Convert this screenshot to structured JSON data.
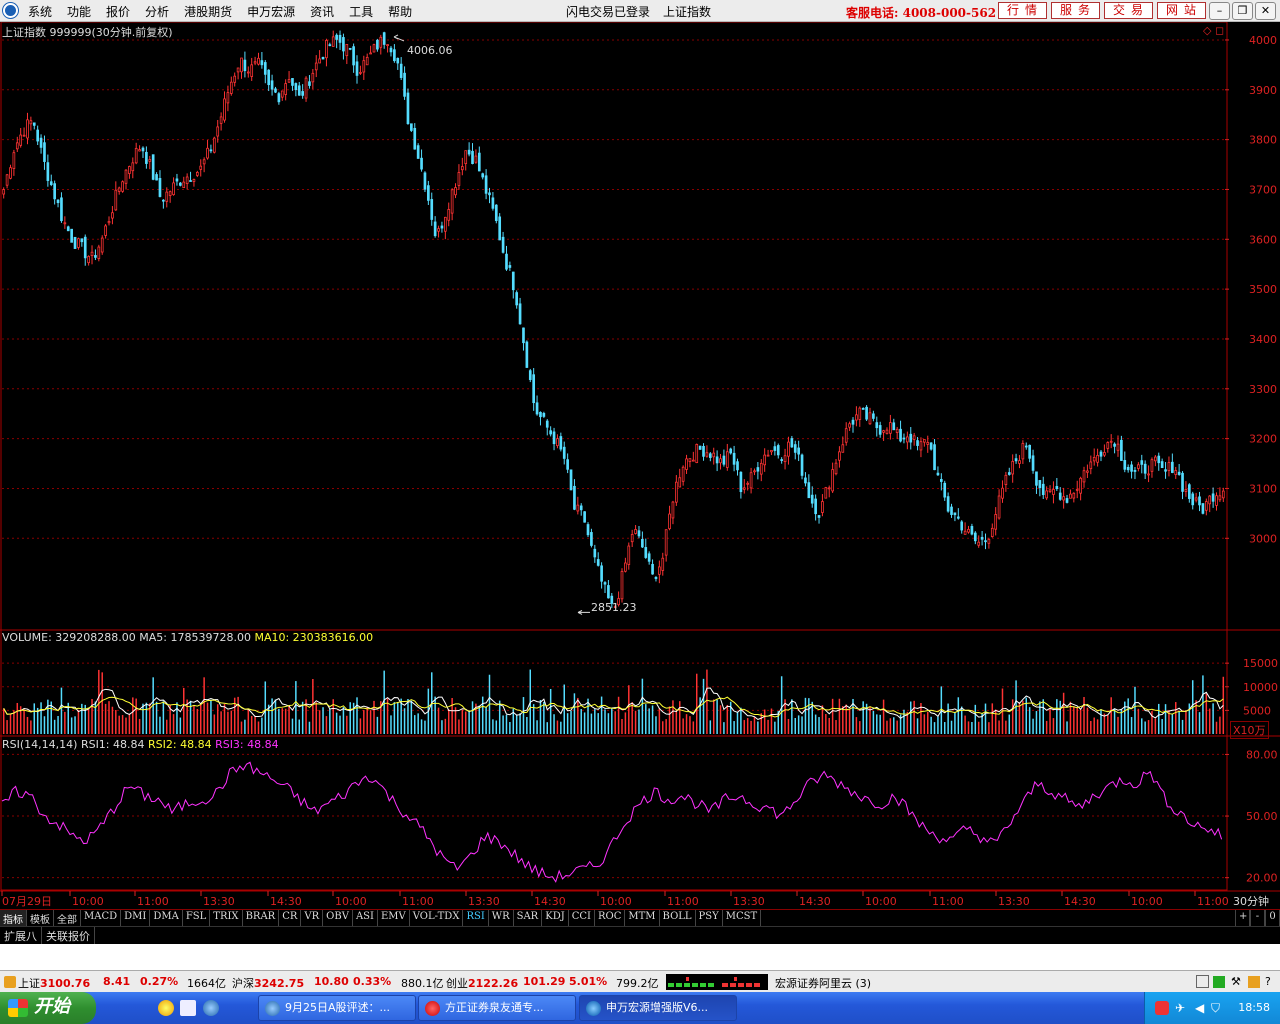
{
  "menubar": {
    "menus": [
      "系统",
      "功能",
      "报价",
      "分析",
      "港股期货",
      "申万宏源",
      "资讯",
      "工具",
      "帮助"
    ],
    "status": "闪电交易已登录",
    "index_name": "上证指数",
    "phone": "客服电话: 4008-000-562",
    "buttons": [
      "行情",
      "服务",
      "交易",
      "网站"
    ]
  },
  "chart_header": {
    "title": "上证指数 999999(30分钟.前复权)",
    "high_label": "4006.06",
    "low_label": "2851.23"
  },
  "volume_header": {
    "label": "VOLUME: 329208288.00",
    "ma5": "MA5: 178539728.00",
    "ma10": "MA10: 230383616.00",
    "unit": "X10万"
  },
  "rsi_header": {
    "label": "RSI(14,14,14)",
    "rsi1": "RSI1: 48.84",
    "rsi2": "RSI2: 48.84",
    "rsi3": "RSI3: 48.84"
  },
  "period_label": "30分钟",
  "colors": {
    "up": "#ff3333",
    "down": "#55ddff",
    "ma5": "#ffffff",
    "ma10": "#ffff33",
    "rsi": "#ff33ff",
    "grid": "#880000"
  },
  "chart_data": {
    "type": "candlestick",
    "price_ticks": [
      "4000",
      "3900",
      "3800",
      "3700",
      "3600",
      "3500",
      "3400",
      "3300",
      "3200",
      "3100",
      "3000"
    ],
    "volume_ticks": [
      "15000",
      "10000",
      "5000"
    ],
    "rsi_ticks": [
      "80.00",
      "50.00",
      "20.00"
    ],
    "x_ticks": [
      "07月29日",
      "10:00",
      "11:00",
      "13:30",
      "14:30",
      "10:00",
      "11:00",
      "13:30",
      "14:30",
      "10:00",
      "11:00",
      "13:30",
      "14:30",
      "10:00",
      "11:00",
      "13:30",
      "14:30",
      "10:00",
      "11:00"
    ],
    "price_path": [
      3700,
      3780,
      3820,
      3840,
      3760,
      3700,
      3640,
      3600,
      3580,
      3560,
      3600,
      3660,
      3720,
      3760,
      3790,
      3740,
      3680,
      3700,
      3720,
      3730,
      3740,
      3780,
      3840,
      3910,
      3960,
      3940,
      3950,
      3900,
      3890,
      3930,
      3880,
      3920,
      3960,
      3990,
      4000,
      3980,
      3940,
      3960,
      3990,
      4006,
      3960,
      3850,
      3780,
      3700,
      3600,
      3660,
      3720,
      3780,
      3760,
      3700,
      3640,
      3560,
      3500,
      3380,
      3260,
      3230,
      3200,
      3160,
      3060,
      3040,
      2960,
      2900,
      2851,
      2930,
      3020,
      2980,
      2920,
      2960,
      3080,
      3150,
      3170,
      3180,
      3170,
      3150,
      3170,
      3100,
      3120,
      3160,
      3180,
      3170,
      3190,
      3150,
      3080,
      3050,
      3120,
      3180,
      3230,
      3250,
      3240,
      3220,
      3230,
      3200,
      3210,
      3180,
      3200,
      3120,
      3060,
      3040,
      3010,
      2990,
      3000,
      3060,
      3120,
      3160,
      3190,
      3120,
      3080,
      3100,
      3080,
      3100,
      3140,
      3160,
      3190,
      3200,
      3150,
      3130,
      3140,
      3150,
      3130,
      3150,
      3100,
      3070,
      3060,
      3090,
      3100
    ],
    "rsi_path": [
      55,
      62,
      60,
      50,
      46,
      40,
      38,
      45,
      55,
      65,
      60,
      58,
      52,
      56,
      58,
      60,
      70,
      75,
      72,
      68,
      64,
      58,
      52,
      56,
      60,
      66,
      70,
      62,
      54,
      48,
      40,
      30,
      24,
      30,
      40,
      38,
      32,
      26,
      22,
      20,
      22,
      24,
      26,
      36,
      48,
      56,
      62,
      58,
      60,
      56,
      52,
      58,
      60,
      56,
      54,
      50,
      58,
      66,
      70,
      66,
      62,
      58,
      56,
      60,
      52,
      44,
      40,
      38,
      44,
      40,
      36,
      46,
      56,
      66,
      62,
      58,
      54,
      60,
      64,
      68,
      66,
      72,
      58,
      52,
      46,
      44,
      40
    ],
    "high": 4006.06,
    "low": 2851.23,
    "ylim": [
      2820,
      4020
    ]
  },
  "tabs": [
    "指标",
    "模板",
    "全部",
    "MACD",
    "DMI",
    "DMA",
    "FSL",
    "TRIX",
    "BRAR",
    "CR",
    "VR",
    "OBV",
    "ASI",
    "EMV",
    "VOL-TDX",
    "RSI",
    "WR",
    "SAR",
    "KDJ",
    "CCI",
    "ROC",
    "MTM",
    "BOLL",
    "PSY",
    "MCST"
  ],
  "tab_controls": [
    "+",
    "-",
    "0"
  ],
  "ext_tabs": [
    "扩展八",
    "关联报价"
  ],
  "statusbar": {
    "sh_name": "上证",
    "sh_value": "3100.76",
    "sh_change": "8.41",
    "sh_pct": "0.27%",
    "sh_amount": "1664亿",
    "hs_name": "沪深",
    "hs_value": "3242.75",
    "hs_change": "10.80",
    "hs_pct": "0.33%",
    "hs_amount": "880.1亿",
    "cy_name": "创业",
    "cy_value": "2122.26",
    "cy_change": "101.29",
    "cy_pct": "5.01%",
    "cy_amount": "799.2亿",
    "broker": "宏源证券阿里云 (3)"
  },
  "taskbar": {
    "start": "开始",
    "tasks": [
      "9月25日A股评述：...",
      "方正证券泉友通专...",
      "申万宏源增强版V6..."
    ],
    "clock": "18:58"
  }
}
